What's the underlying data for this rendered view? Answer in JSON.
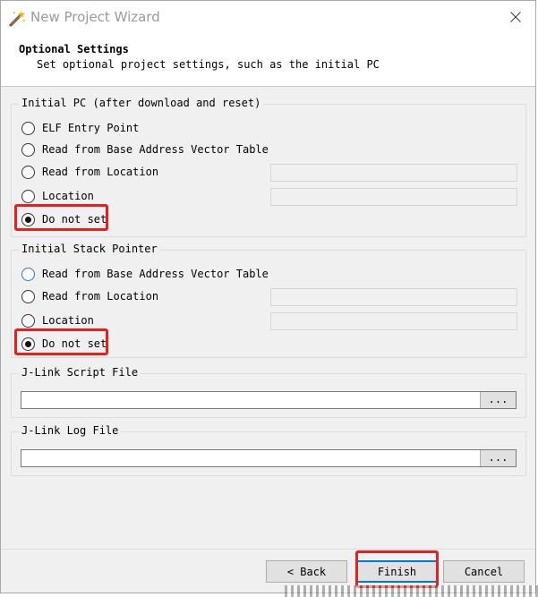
{
  "window": {
    "title": "New Project Wizard",
    "icon": "magic-wand-icon",
    "close_icon": "close-icon"
  },
  "header": {
    "title": "Optional Settings",
    "subtitle": "Set optional project settings, such as the initial PC"
  },
  "initial_pc": {
    "legend": "Initial PC (after download and reset)",
    "options": [
      {
        "label": "ELF Entry Point",
        "checked": false
      },
      {
        "label": "Read from Base Address Vector Table",
        "checked": false
      },
      {
        "label": "Read from Location",
        "checked": false,
        "field_value": ""
      },
      {
        "label": "Location",
        "checked": false,
        "field_value": ""
      },
      {
        "label": "Do not set",
        "checked": true
      }
    ]
  },
  "initial_sp": {
    "legend": "Initial Stack Pointer",
    "options": [
      {
        "label": "Read from Base Address Vector Table",
        "checked": false
      },
      {
        "label": "Read from Location",
        "checked": false,
        "field_value": ""
      },
      {
        "label": "Location",
        "checked": false,
        "field_value": ""
      },
      {
        "label": "Do not set",
        "checked": true
      }
    ]
  },
  "script_file": {
    "legend": "J-Link Script File",
    "value": "",
    "browse_label": "..."
  },
  "log_file": {
    "legend": "J-Link Log File",
    "value": "",
    "browse_label": "..."
  },
  "footer": {
    "back_label": "< Back",
    "finish_label": "Finish",
    "cancel_label": "Cancel"
  },
  "colors": {
    "highlight": "#e5201f",
    "default_button_border": "#0078d7"
  }
}
